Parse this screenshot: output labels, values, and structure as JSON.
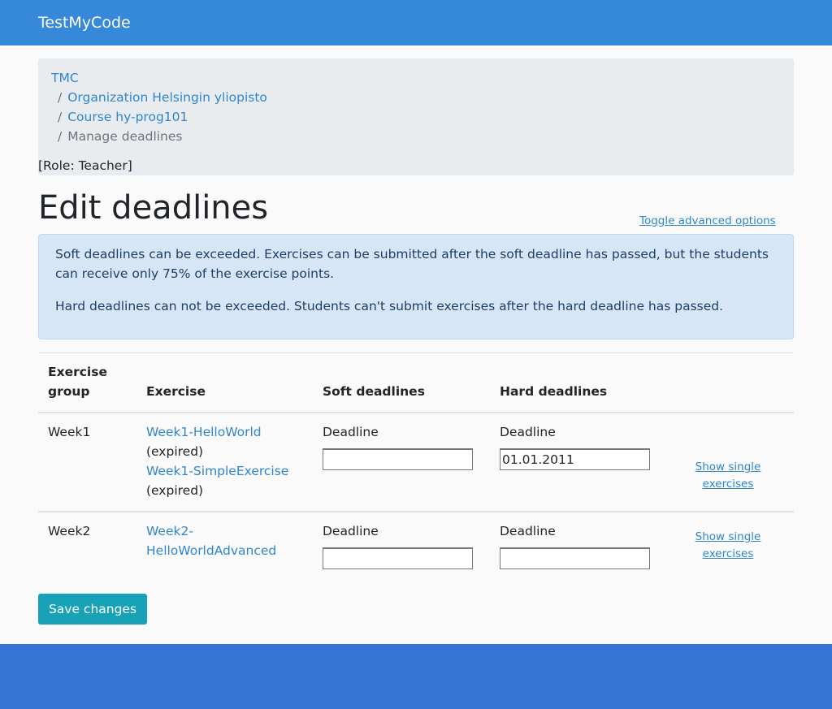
{
  "app": {
    "brand": "TestMyCode"
  },
  "breadcrumb": {
    "root": "TMC",
    "separator": "/",
    "organization": "Organization Helsingin yliopisto",
    "course": "Course hy-prog101",
    "current": "Manage deadlines"
  },
  "role": "[Role: Teacher]",
  "page": {
    "title": "Edit deadlines",
    "toggle_advanced": "Toggle advanced options"
  },
  "info": {
    "soft": "Soft deadlines can be exceeded. Exercises can be submitted after the soft deadline has passed, but the students can receive only 75% of the exercise points.",
    "hard": "Hard deadlines can not be exceeded. Students can't submit exercises after the hard deadline has passed."
  },
  "table": {
    "headers": {
      "group_line1": "Exercise",
      "group_line2": "group",
      "exercise": "Exercise",
      "soft": "Soft deadlines",
      "hard": "Hard deadlines"
    },
    "rows": [
      {
        "group": "Week1",
        "exercises": [
          {
            "name": "Week1-HelloWorld",
            "status": "(expired)"
          },
          {
            "name": "Week1-SimpleExercise",
            "status": "(expired)"
          }
        ],
        "soft_label": "Deadline",
        "soft_value": "",
        "hard_label": "Deadline",
        "hard_value": "01.01.2011",
        "show_line1": "Show single",
        "show_line2": "exercises"
      },
      {
        "group": "Week2",
        "exercises": [
          {
            "name_line1": "Week2-",
            "name_line2": "HelloWorldAdvanced"
          }
        ],
        "soft_label": "Deadline",
        "soft_value": "",
        "hard_label": "Deadline",
        "hard_value": "",
        "show_line1": "Show single",
        "show_line2": "exercises"
      }
    ]
  },
  "actions": {
    "save": "Save changes"
  },
  "colors": {
    "navbar": "#3689d8",
    "footer": "#3575d6",
    "link": "#2f86cf",
    "save_button": "#17a2b8",
    "alert_bg": "#d6e6f7"
  }
}
